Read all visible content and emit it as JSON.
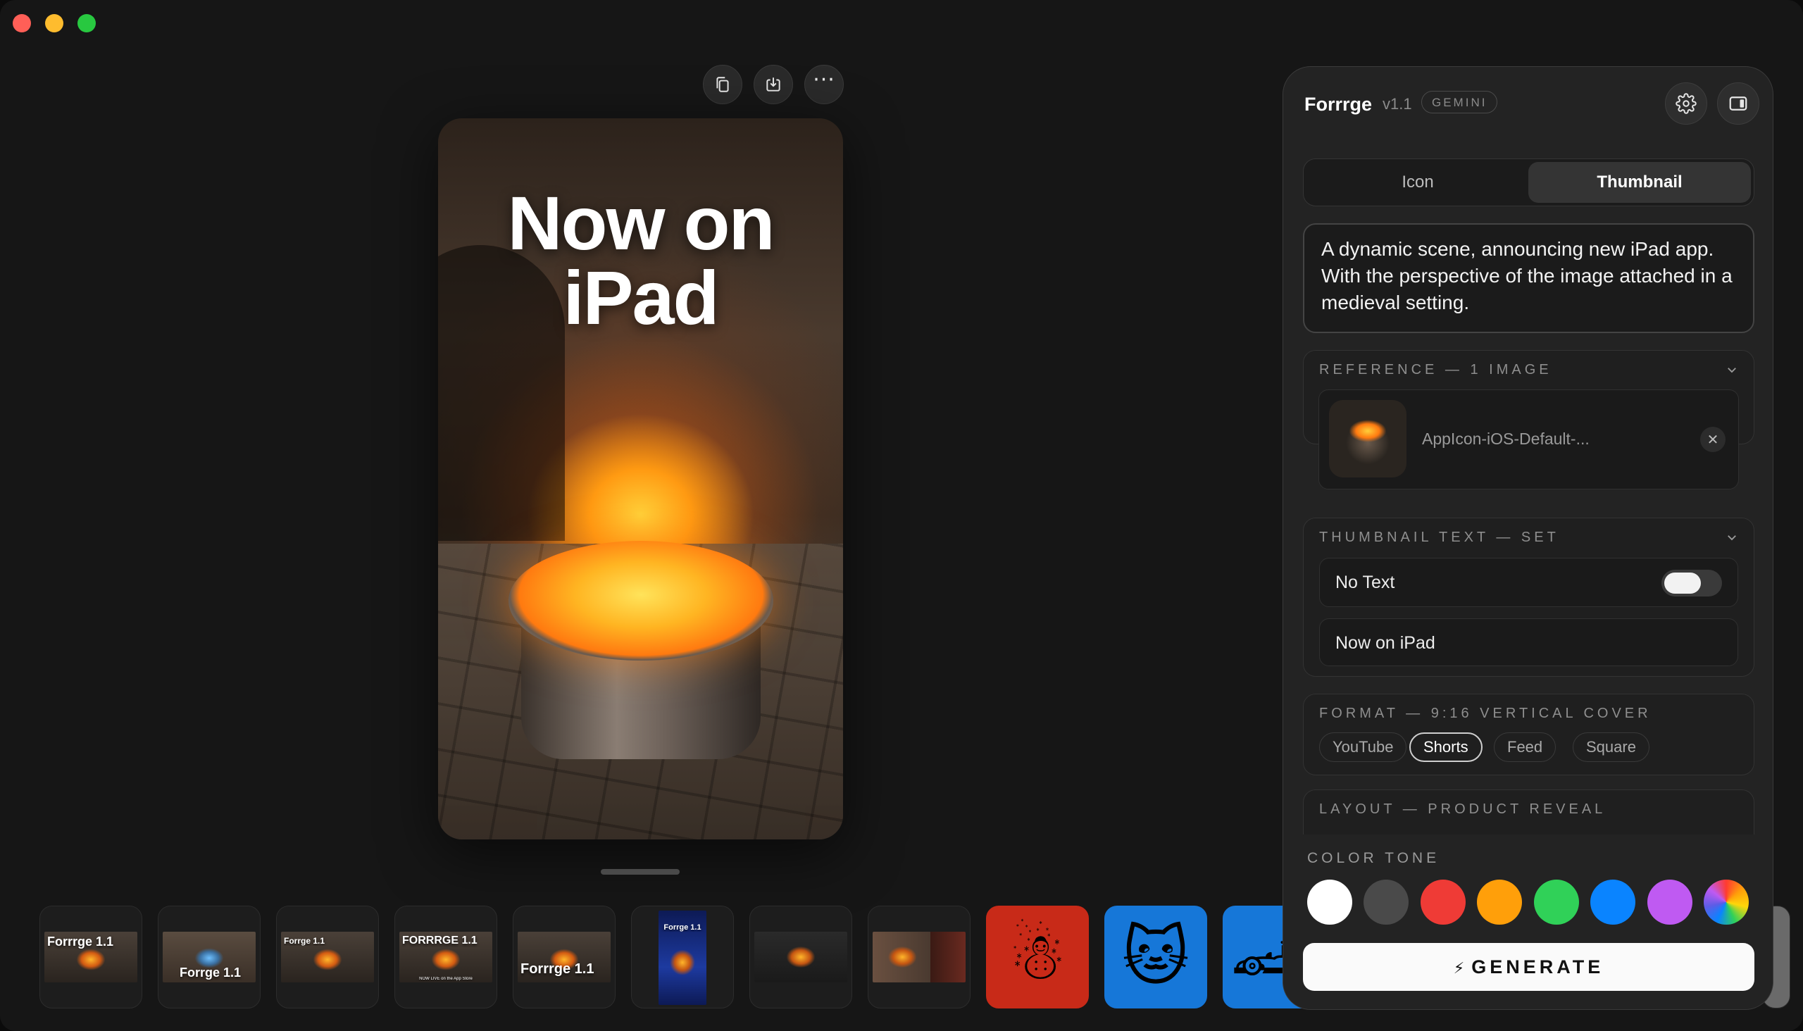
{
  "window": {
    "controls": [
      "close",
      "minimize",
      "zoom"
    ]
  },
  "canvas": {
    "toolbar": [
      {
        "name": "copy-button",
        "icon": "copy-icon"
      },
      {
        "name": "download-button",
        "icon": "download-icon"
      },
      {
        "name": "more-button",
        "icon": "ellipsis-icon",
        "label": "···"
      }
    ],
    "preview_text": "Now on\niPad"
  },
  "thumbnails": [
    {
      "label": "Forrrge 1.1",
      "kind": "landscape"
    },
    {
      "label": "Forrge 1.1",
      "kind": "landscape-ice"
    },
    {
      "label": "Forrge 1.1",
      "kind": "landscape-small"
    },
    {
      "label": "FORRRGE 1.1",
      "sub": "NOW LIVE on the App Store",
      "kind": "landscape"
    },
    {
      "label": "Forrrge 1.1",
      "kind": "landscape"
    },
    {
      "label": "Forrge 1.1",
      "kind": "portrait"
    },
    {
      "label": "",
      "kind": "landscape"
    },
    {
      "label": "",
      "kind": "landscape-panel"
    },
    {
      "label": "",
      "kind": "icon-red",
      "emoji": "☃"
    },
    {
      "label": "",
      "kind": "icon-blue",
      "emoji": "🐱"
    },
    {
      "label": "",
      "kind": "icon-blue",
      "emoji": "🏎"
    }
  ],
  "panel": {
    "app_name": "Forrrge",
    "version": "v1.1",
    "badge": "GEMINI",
    "tabs": [
      {
        "label": "Icon",
        "active": false
      },
      {
        "label": "Thumbnail",
        "active": true
      }
    ],
    "prompt": "A dynamic scene, announcing new iPad app. With the perspective of the image attached in a medieval setting.",
    "reference": {
      "title": "REFERENCE — 1 IMAGE",
      "file_name": "AppIcon-iOS-Default-..."
    },
    "thumbnail_text": {
      "title": "THUMBNAIL TEXT — SET",
      "no_text_label": "No Text",
      "no_text_enabled": false,
      "text_value": "Now on iPad"
    },
    "format": {
      "title": "FORMAT — 9:16 VERTICAL COVER",
      "options": [
        "YouTube",
        "Shorts",
        "Feed",
        "Square"
      ],
      "selected": "Shorts"
    },
    "layout": {
      "title": "LAYOUT — PRODUCT REVEAL"
    },
    "color_tone": {
      "title": "COLOR TONE",
      "swatches": [
        "#ffffff",
        "#4a4a4a",
        "#ef3b36",
        "#ff9f0a",
        "#30d158",
        "#0a84ff",
        "#bf5af2",
        "rainbow"
      ]
    },
    "generate_label": "GENERATE"
  }
}
